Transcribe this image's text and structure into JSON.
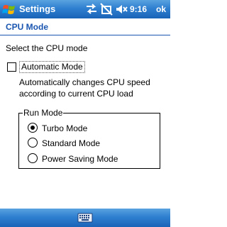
{
  "titlebar": {
    "title": "Settings",
    "time": "9:16",
    "ok_label": "ok",
    "icons": [
      "windows-start-icon",
      "connectivity-icon",
      "missed-call-icon",
      "volume-mute-icon"
    ]
  },
  "page": {
    "title": "CPU Mode",
    "section_label": "Select the CPU mode"
  },
  "automatic": {
    "label": "Automatic Mode",
    "checked": false,
    "description": "Automatically changes CPU speed according to current CPU load"
  },
  "run_mode": {
    "group_title": "Run Mode",
    "options": [
      {
        "label": "Turbo Mode",
        "selected": true
      },
      {
        "label": "Standard Mode",
        "selected": false
      },
      {
        "label": "Power Saving Mode",
        "selected": false
      }
    ]
  },
  "bottombar": {
    "icon": "keyboard-icon"
  },
  "colors": {
    "bar_blue": "#2f7fd0",
    "header_text": "#1a56b0"
  }
}
